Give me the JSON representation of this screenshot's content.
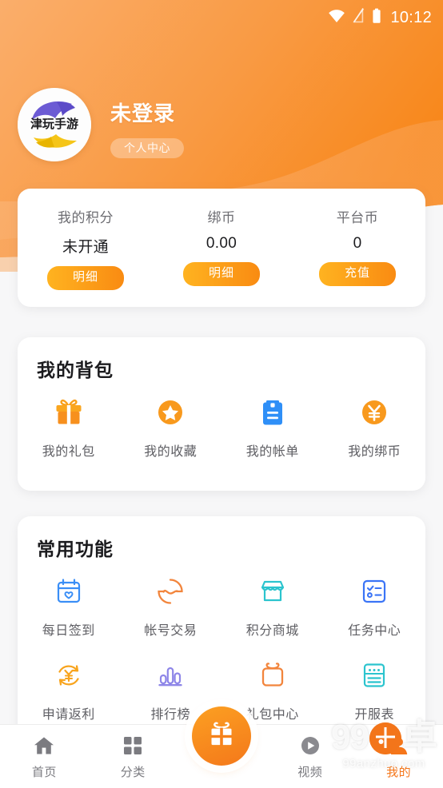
{
  "status_bar": {
    "time": "10:12",
    "icons": [
      "wifi-icon",
      "signal-off-icon",
      "battery-icon"
    ]
  },
  "profile": {
    "nickname": "未登录",
    "center_button": "个人中心",
    "avatar_text": "津玩手游",
    "avatar_name": "user-avatar-logo"
  },
  "stats": {
    "items": [
      {
        "label": "我的积分",
        "value": "未开通",
        "button": "明细",
        "name": "points"
      },
      {
        "label": "绑币",
        "value": "0.00",
        "button": "明细",
        "name": "bound-coin"
      },
      {
        "label": "平台币",
        "value": "0",
        "button": "充值",
        "name": "platform-coin"
      }
    ]
  },
  "backpack": {
    "title": "我的背包",
    "items": [
      {
        "label": "我的礼包",
        "icon": "gift-box-icon",
        "color": "#F8991D"
      },
      {
        "label": "我的收藏",
        "icon": "star-circle-icon",
        "color": "#F8991D"
      },
      {
        "label": "我的帐单",
        "icon": "clipboard-icon",
        "color": "#2F8FF7"
      },
      {
        "label": "我的绑币",
        "icon": "yen-circle-icon",
        "color": "#F8991D"
      }
    ]
  },
  "functions": {
    "title": "常用功能",
    "items": [
      {
        "label": "每日签到",
        "icon": "calendar-heart-icon",
        "color": "#3A8EF6"
      },
      {
        "label": "帐号交易",
        "icon": "exchange-circle-icon",
        "color": "#F2853C"
      },
      {
        "label": "积分商城",
        "icon": "shop-icon",
        "color": "#2BC4CE"
      },
      {
        "label": "任务中心",
        "icon": "checklist-icon",
        "color": "#3A74F6"
      },
      {
        "label": "申请返利",
        "icon": "yen-refresh-icon",
        "color": "#F8A41D"
      },
      {
        "label": "排行榜",
        "icon": "bar-chart-icon",
        "color": "#8E86E8"
      },
      {
        "label": "礼包中心",
        "icon": "gift-outline-icon",
        "color": "#F2853C"
      },
      {
        "label": "开服表",
        "icon": "server-list-icon",
        "color": "#2BC4CE"
      }
    ]
  },
  "tabbar": {
    "items": [
      {
        "label": "首页",
        "icon": "home-icon",
        "active": false
      },
      {
        "label": "分类",
        "icon": "grid-icon",
        "active": false
      },
      {
        "label": "视频",
        "icon": "play-icon",
        "active": false
      },
      {
        "label": "我的",
        "icon": "user-icon",
        "active": true
      }
    ],
    "fab": {
      "icon": "gift-icon",
      "name": "gift-fab"
    }
  },
  "watermark": {
    "main_left": "99",
    "badge": "安",
    "main_right": "卓",
    "sub": "99anzhuo.com"
  },
  "colors": {
    "accent": "#F5761A",
    "header_start": "#F9A75D",
    "header_end": "#F98A22",
    "page_bg": "#F7F7F8"
  }
}
